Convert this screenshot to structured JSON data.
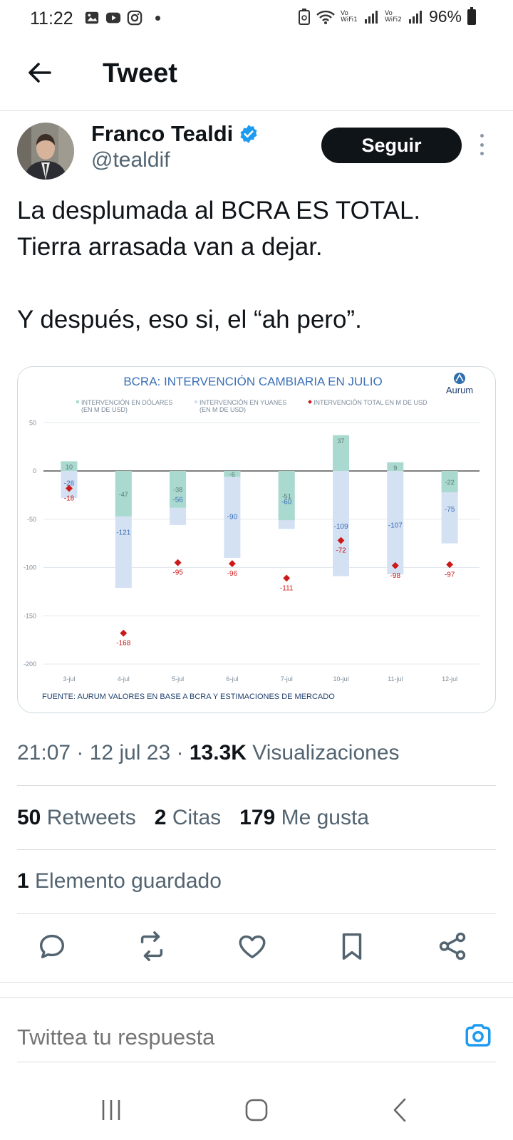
{
  "status_bar": {
    "time": "11:22",
    "wifi1": "Vo WiFi1",
    "wifi2": "Vo WiFi2",
    "battery": "96%",
    "left_icons": [
      "gallery-icon",
      "youtube-icon",
      "instagram-icon"
    ]
  },
  "header": {
    "title": "Tweet"
  },
  "author": {
    "name": "Franco Tealdi",
    "handle": "@tealdif",
    "verified_color": "#1d9bf0",
    "follow_label": "Seguir"
  },
  "tweet": {
    "line1": "La desplumada al BCRA ES TOTAL.",
    "line2": "Tierra arrasada van a dejar.",
    "line3": "Y después, eso si, el “ah pero”."
  },
  "chart_data": {
    "type": "bar",
    "title": "BCRA: INTERVENCIÓN CAMBIARIA EN JULIO",
    "brand": "Aurum",
    "legend": [
      "INTERVENCIÓN EN DÓLARES (EN M DE USD)",
      "INTERVENCIÓN EN YUANES (EN M DE USD)",
      "INTERVENCIÓN TOTAL EN M DE USD"
    ],
    "categories": [
      "3-jul",
      "4-jul",
      "5-jul",
      "6-jul",
      "7-jul",
      "10-jul",
      "11-jul",
      "12-jul"
    ],
    "series": [
      {
        "name": "INTERVENCIÓN EN DÓLARES (EN M DE USD)",
        "values": [
          10,
          -47,
          -38,
          -6,
          -51,
          37,
          9,
          -22
        ]
      },
      {
        "name": "INTERVENCIÓN EN YUANES (EN M DE USD)",
        "values": [
          -28,
          -121,
          -56,
          -90,
          -60,
          -109,
          -107,
          -75
        ]
      },
      {
        "name": "INTERVENCIÓN TOTAL EN M DE USD",
        "values": [
          -18,
          -168,
          -95,
          -96,
          -111,
          -72,
          -98,
          -97
        ]
      }
    ],
    "yticks": [
      50,
      0,
      -50,
      -100,
      -150,
      -200
    ],
    "ylim": [
      -200,
      50
    ],
    "source": "FUENTE: AURUM VALORES EN BASE A BCRA Y ESTIMACIONES DE MERCADO",
    "colors": {
      "dollars": "#a9d9cf",
      "yuan": "#d3e1f3",
      "total": "#cc1a1a",
      "title": "#3a6fb5"
    }
  },
  "meta": {
    "time": "21:07",
    "date": "12 jul 23",
    "views_count": "13.3K",
    "views_label": "Visualizaciones"
  },
  "stats": {
    "retweets_count": "50",
    "retweets_label": "Retweets",
    "quotes_count": "2",
    "quotes_label": "Citas",
    "likes_count": "179",
    "likes_label": "Me gusta",
    "saved_count": "1",
    "saved_label": "Elemento guardado"
  },
  "reply": {
    "placeholder": "Twittea tu respuesta"
  },
  "actions": [
    "reply-icon",
    "retweet-icon",
    "like-icon",
    "bookmark-icon",
    "share-icon"
  ],
  "accent": "#1d9bf0"
}
